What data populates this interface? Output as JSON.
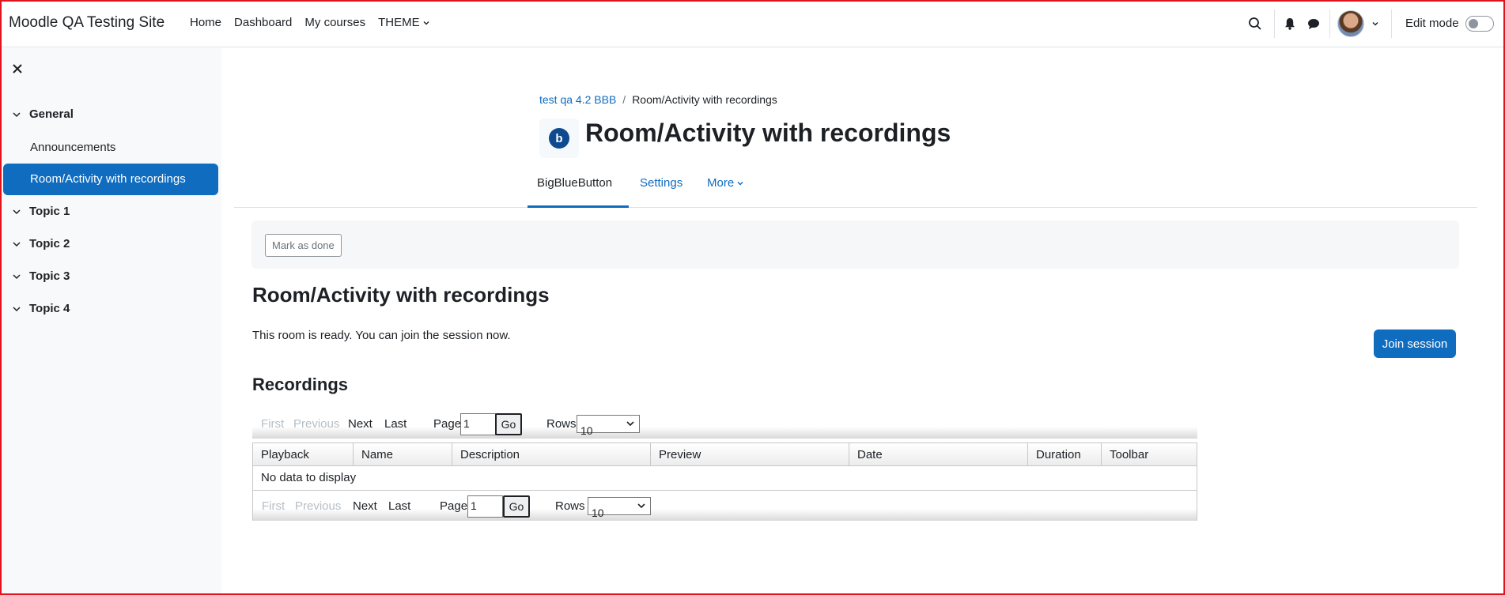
{
  "navbar": {
    "site_name": "Moodle QA Testing Site",
    "links": [
      "Home",
      "Dashboard",
      "My courses",
      "THEME"
    ],
    "edit_mode_label": "Edit mode"
  },
  "drawer": {
    "sections": [
      {
        "label": "General"
      },
      {
        "label": "Topic 1"
      },
      {
        "label": "Topic 2"
      },
      {
        "label": "Topic 3"
      },
      {
        "label": "Topic 4"
      }
    ],
    "activities": [
      "Announcements",
      "Room/Activity with recordings"
    ]
  },
  "breadcrumb": {
    "course": "test qa 4.2 BBB",
    "separator": "/",
    "current": "Room/Activity with recordings"
  },
  "page": {
    "icon_letter": "b",
    "title": "Room/Activity with recordings",
    "tabs": [
      "BigBlueButton",
      "Settings",
      "More"
    ],
    "mark_done": "Mark as done",
    "room_heading": "Room/Activity with recordings",
    "ready_text": "This room is ready. You can join the session now.",
    "join_button": "Join session",
    "recordings_heading": "Recordings"
  },
  "pager": {
    "first": "First",
    "previous": "Previous",
    "next": "Next",
    "last": "Last",
    "page_label": "Page",
    "page_value": "1",
    "go": "Go",
    "rows_label": "Rows",
    "rows_value": "10"
  },
  "table": {
    "columns": [
      "Playback",
      "Name",
      "Description",
      "Preview",
      "Date",
      "Duration",
      "Toolbar"
    ],
    "empty_message": "No data to display"
  },
  "colors": {
    "brand": "#0f6cbf",
    "frame": "#e0141e"
  }
}
